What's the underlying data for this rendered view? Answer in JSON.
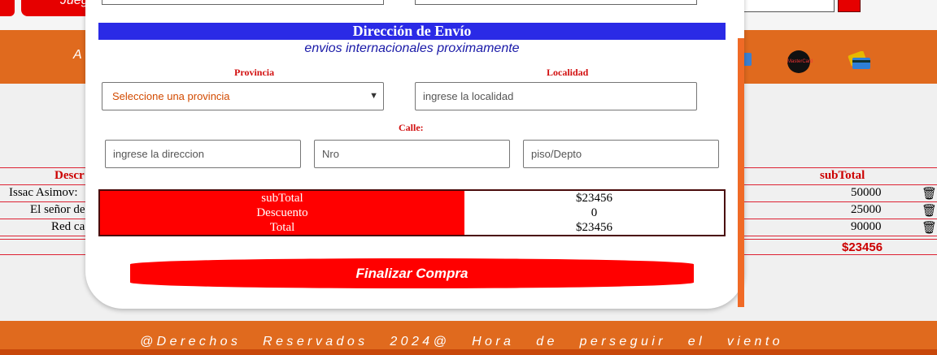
{
  "background": {
    "top_button_label": "Jueg",
    "nav_text": "A",
    "payment_icon_label": "MasterCard",
    "table": {
      "headers": [
        "Descr",
        "subTotal"
      ],
      "rows": [
        {
          "name": "Issac Asimov:",
          "subtotal": "50000"
        },
        {
          "name": "El señor de",
          "subtotal": "25000"
        },
        {
          "name": "Red ca",
          "subtotal": "90000"
        }
      ],
      "total": "$23456"
    },
    "footer_text": "@Derechos Reservados 2024@ Hora de perseguir el viento"
  },
  "shipping": {
    "title": "Dirección de Envío",
    "subtitle": "envios internacionales proximamente",
    "province_label": "Provincia",
    "province_value": "Seleccione una provincia",
    "locality_label": "Localidad",
    "locality_placeholder": "ingrese la localidad",
    "street_label": "Calle:",
    "address_placeholder": "ingrese la direccion",
    "number_placeholder": "Nro",
    "floor_placeholder": "piso/Depto"
  },
  "totals": {
    "labels": [
      "subTotal",
      "Descuento",
      "Total"
    ],
    "values": [
      "$23456",
      "0",
      "$23456"
    ]
  },
  "finish_button_label": "Finalizar Compra",
  "colors": {
    "accent_red": "#ff0000",
    "title_blue": "#2a2ae6",
    "nav_orange": "#e06a1e"
  }
}
